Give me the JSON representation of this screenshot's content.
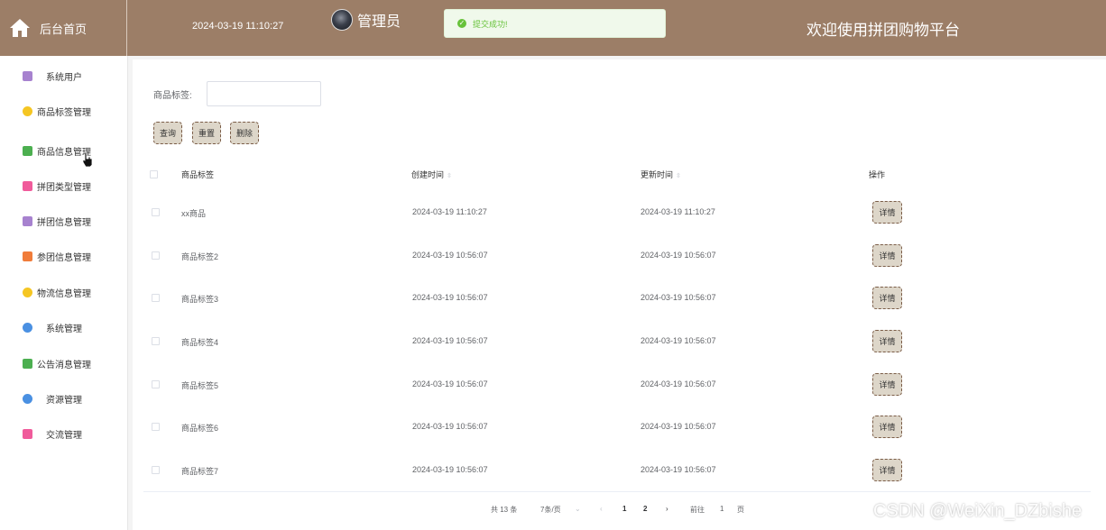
{
  "header": {
    "brand_label": "后台首页",
    "datetime": "2024-03-19 11:10:27",
    "admin_label": "管理员",
    "toast_text": "提交成功!",
    "welcome": "欢迎使用拼团购物平台",
    "color": "#9c7e67"
  },
  "sidebar": {
    "items": [
      {
        "label": "系统用户",
        "icon": "user-group-icon",
        "color": "#a782cf"
      },
      {
        "label": "商品标签管理",
        "icon": "tag-icon",
        "color": "#f5c623"
      },
      {
        "label": "商品信息管理",
        "icon": "message-icon",
        "color": "#4caf50"
      },
      {
        "label": "拼团类型管理",
        "icon": "document-icon",
        "color": "#f05b9b"
      },
      {
        "label": "拼团信息管理",
        "icon": "user-group-icon",
        "color": "#a782cf"
      },
      {
        "label": "参团信息管理",
        "icon": "grid-icon",
        "color": "#f07c3a"
      },
      {
        "label": "物流信息管理",
        "icon": "tag-icon",
        "color": "#f5c623"
      },
      {
        "label": "系统管理",
        "icon": "star-icon",
        "color": "#4a90e2"
      },
      {
        "label": "公告消息管理",
        "icon": "message-icon",
        "color": "#4caf50"
      },
      {
        "label": "资源管理",
        "icon": "star-icon",
        "color": "#4a90e2"
      },
      {
        "label": "交流管理",
        "icon": "document-icon",
        "color": "#f05b9b"
      }
    ]
  },
  "filter": {
    "label": "商品标签:",
    "input_value": ""
  },
  "buttons": {
    "query": "查询",
    "reset": "重置",
    "delete": "删除"
  },
  "table": {
    "headers": [
      "商品标签",
      "创建时间",
      "更新时间",
      "操作"
    ],
    "detail_label": "详情",
    "rows": [
      {
        "tag": "xx商品",
        "created": "2024-03-19 11:10:27",
        "updated": "2024-03-19 11:10:27"
      },
      {
        "tag": "商品标签2",
        "created": "2024-03-19 10:56:07",
        "updated": "2024-03-19 10:56:07"
      },
      {
        "tag": "商品标签3",
        "created": "2024-03-19 10:56:07",
        "updated": "2024-03-19 10:56:07"
      },
      {
        "tag": "商品标签4",
        "created": "2024-03-19 10:56:07",
        "updated": "2024-03-19 10:56:07"
      },
      {
        "tag": "商品标签5",
        "created": "2024-03-19 10:56:07",
        "updated": "2024-03-19 10:56:07"
      },
      {
        "tag": "商品标签6",
        "created": "2024-03-19 10:56:07",
        "updated": "2024-03-19 10:56:07"
      },
      {
        "tag": "商品标签7",
        "created": "2024-03-19 10:56:07",
        "updated": "2024-03-19 10:56:07"
      }
    ]
  },
  "pagination": {
    "total": "共 13 条",
    "page_size": "7条/页",
    "pages": [
      "1",
      "2"
    ],
    "current_page": "1",
    "goto_label": "前往",
    "goto_value": "1",
    "page_unit": "页"
  },
  "watermark": "CSDN @WeiXin_DZbishe"
}
